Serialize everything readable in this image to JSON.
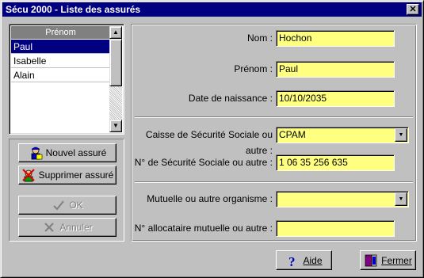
{
  "window": {
    "title": "Sécu 2000 - Liste des assurés",
    "close_glyph": "✕"
  },
  "list": {
    "header": "Prénom",
    "rows": [
      "Paul",
      "Isabelle",
      "Alain"
    ],
    "selected_index": 0
  },
  "buttons": {
    "new": "Nouvel assuré",
    "delete": "Supprimer assuré",
    "ok": "OK",
    "cancel": "Annuler",
    "help": "Aide",
    "close": "Fermer"
  },
  "form": {
    "nom": {
      "label": "Nom :",
      "value": "Hochon"
    },
    "prenom": {
      "label": "Prénom :",
      "value": "Paul"
    },
    "naissance": {
      "label": "Date de naissance :",
      "value": "10/10/2035"
    },
    "caisse": {
      "label": "Caisse de Sécurité Sociale ou autre :",
      "value": "CPAM"
    },
    "numero_secu": {
      "label": "N° de Sécurité Sociale ou autre :",
      "value": "1 06 35 256 635"
    },
    "mutuelle": {
      "label": "Mutuelle ou autre organisme :",
      "value": ""
    },
    "allocataire": {
      "label": "N° allocataire mutuelle ou autre :",
      "value": ""
    }
  },
  "colors": {
    "field_bg": "#ffff80",
    "selection": "#000080",
    "face": "#c0c0c0"
  }
}
